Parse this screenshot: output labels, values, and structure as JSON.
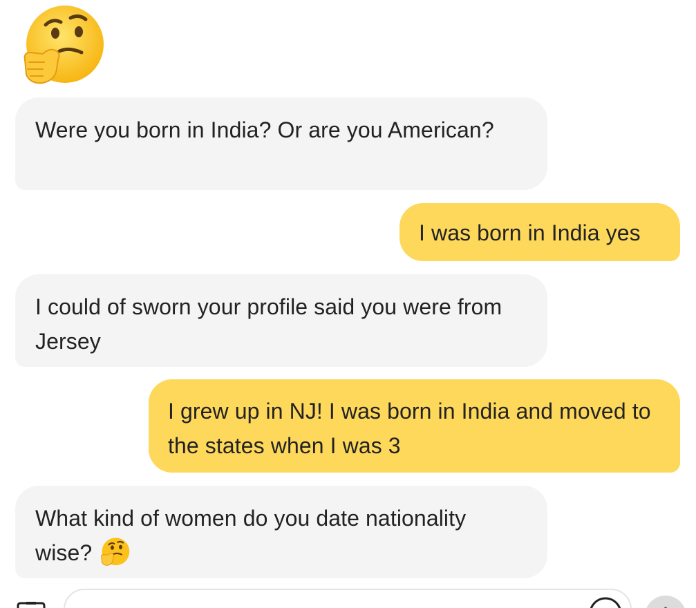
{
  "conversation": {
    "header_reaction": {
      "icon": "thinking-face-icon"
    },
    "messages": [
      {
        "id": "msg1",
        "direction": "incoming",
        "text": "Were you born in India? Or are you American?"
      },
      {
        "id": "msg2",
        "direction": "outgoing",
        "text": "I was born in India yes"
      },
      {
        "id": "msg3",
        "direction": "incoming",
        "text": "I could of sworn your profile said you were from Jersey"
      },
      {
        "id": "msg4",
        "direction": "outgoing",
        "text": "I grew up in NJ! I was born in India and moved to the states when I was 3"
      },
      {
        "id": "msg5",
        "direction": "incoming",
        "text": "What kind of women do you date nationality wise?",
        "trailing_icon": "thinking-face-icon"
      }
    ]
  },
  "composer": {
    "attach_icon": "camera-icon",
    "input_value": "",
    "emoji_icon": "smiley-icon",
    "send_icon": "send-icon"
  },
  "colors": {
    "incoming_bubble": "#f4f4f4",
    "outgoing_bubble": "#fdd85b",
    "text": "#222222",
    "emoji_face": "#fcc21b"
  }
}
